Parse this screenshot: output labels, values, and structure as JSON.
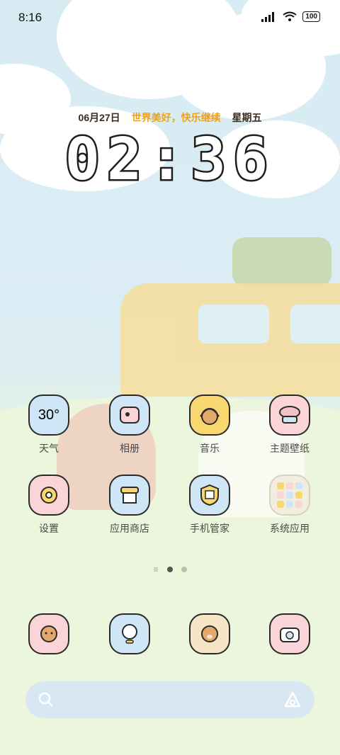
{
  "status_bar": {
    "time": "8:16",
    "battery": "100"
  },
  "lockscreen_widget": {
    "date": "06月27日",
    "slogan": "世界美好，快乐继续",
    "weekday": "星期五",
    "clock": "02:36"
  },
  "apps_row1": [
    {
      "label": "天气",
      "icon_text": "30°",
      "color": "#cfe6f6"
    },
    {
      "label": "相册",
      "icon_text": "",
      "color": "#cfe6f6"
    },
    {
      "label": "音乐",
      "icon_text": "",
      "color": "#f8d770"
    },
    {
      "label": "主题壁纸",
      "icon_text": "",
      "color": "#fbd4d8"
    }
  ],
  "apps_row2": [
    {
      "label": "设置",
      "icon_text": "",
      "color": "#fbd4d8"
    },
    {
      "label": "应用商店",
      "icon_text": "",
      "color": "#cfe6f6"
    },
    {
      "label": "手机管家",
      "icon_text": "",
      "color": "#cfe6f6"
    },
    {
      "label": "系统应用",
      "icon_text": "",
      "color": "#f2eedf"
    }
  ],
  "dock": [
    {
      "color": "#fbd4d8"
    },
    {
      "color": "#cfe6f6"
    },
    {
      "color": "#f6e6c6"
    },
    {
      "color": "#fbd4d8"
    }
  ],
  "page_indicator": {
    "pages": 2,
    "active": 1
  }
}
